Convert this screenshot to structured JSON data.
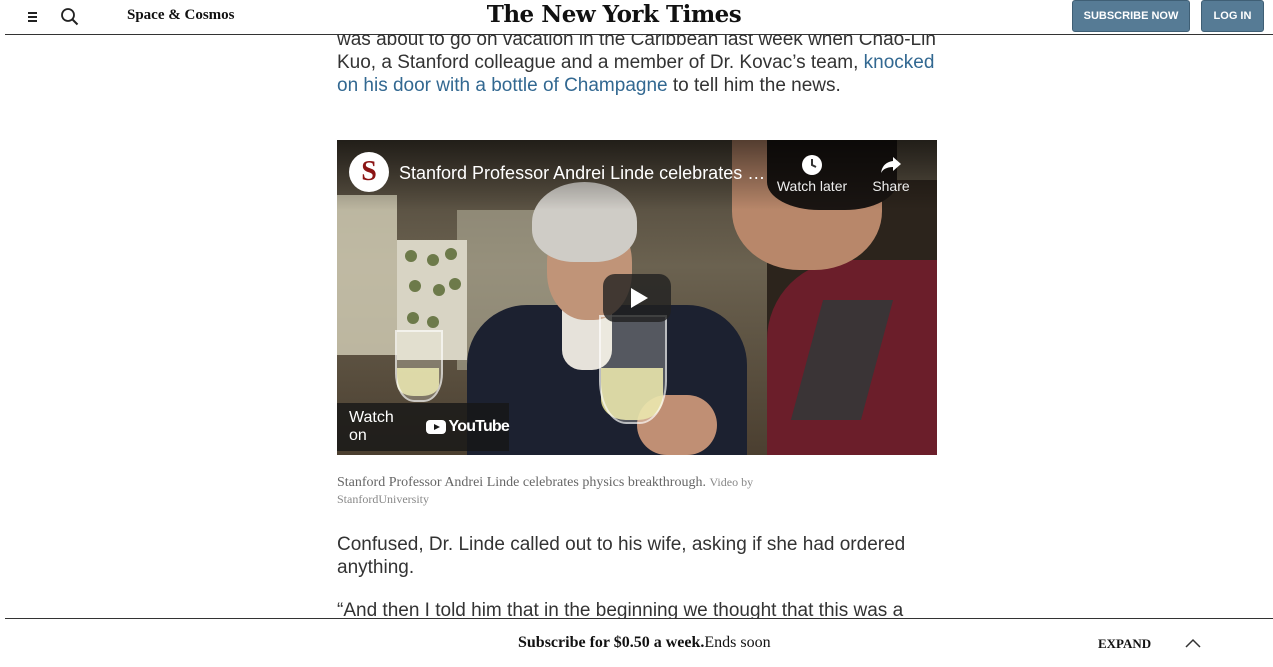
{
  "header": {
    "section": "Space & Cosmos",
    "masthead": "The New York Times",
    "subscribe_label": "SUBSCRIBE NOW",
    "login_label": "LOG IN",
    "accent_color": "#567b95"
  },
  "article": {
    "para1_before": "was about to go on vacation in the Caribbean last week when Chao-Lin Kuo, a Stanford colleague and a member of Dr. Kovac’s team, ",
    "para1_link": "knocked on his door with a bottle of Champagne",
    "para1_after": " to tell him the news.",
    "para2": "Confused, Dr. Linde called out to his wife, asking if she had ordered anything.",
    "para3": "“And then I told him that in the beginning we thought that this was a",
    "link_color": "#326891"
  },
  "video": {
    "title": "Stanford Professor Andrei Linde celebrates …",
    "channel_logo_letter": "S",
    "watch_later_label": "Watch later",
    "share_label": "Share",
    "watch_on_label": "Watch on",
    "youtube_wordmark": "YouTube",
    "icons": [
      "clock-icon",
      "share-arrow-icon",
      "play-icon",
      "youtube-logo-icon"
    ]
  },
  "caption": {
    "text": "Stanford Professor Andrei Linde celebrates physics breakthrough.",
    "credit": "Video by StanfordUniversity"
  },
  "bottom_bar": {
    "promo_bold": "Subscribe for $0.50 a week.",
    "promo_rest": "Ends soon",
    "expand_label": "EXPAND"
  }
}
